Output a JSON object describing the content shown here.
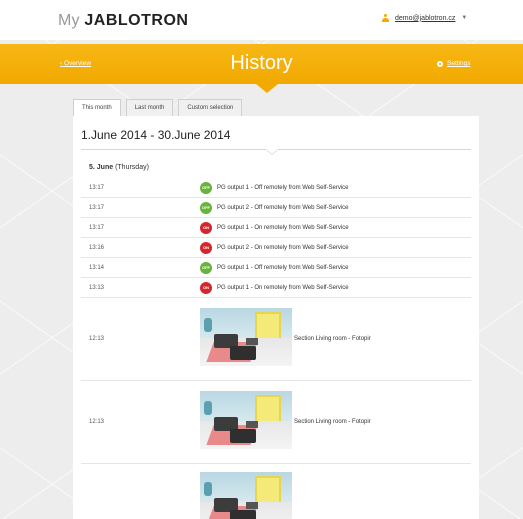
{
  "header": {
    "logo_my": "My",
    "logo_brand": "JABLOTRON",
    "user_email": "demo@jablotron.cz",
    "user_caret": "▼"
  },
  "nav": {
    "title": "History",
    "overview": "‹ Overview",
    "settings": "Settings"
  },
  "tabs": [
    {
      "label": "This month",
      "active": true
    },
    {
      "label": "Last month",
      "active": false
    },
    {
      "label": "Custom selection",
      "active": false
    }
  ],
  "range": "1.June 2014 - 30.June 2014",
  "day": {
    "date": "5. June",
    "weekday": "(Thursday)"
  },
  "events": [
    {
      "time": "13:17",
      "state": "OFF",
      "message": "PG output 1 - Off remotely from Web Self-Service"
    },
    {
      "time": "13:17",
      "state": "OFF",
      "message": "PG output 2 - Off remotely from Web Self-Service"
    },
    {
      "time": "13:17",
      "state": "ON",
      "message": "PG output 1 - On remotely from Web Self-Service"
    },
    {
      "time": "13:16",
      "state": "ON",
      "message": "PG output 2 - On remotely from Web Self-Service"
    },
    {
      "time": "13:14",
      "state": "OFF",
      "message": "PG output 1 - Off remotely from Web Self-Service"
    },
    {
      "time": "13:13",
      "state": "ON",
      "message": "PG output 1 - On remotely from Web Self-Service"
    }
  ],
  "photos": [
    {
      "time": "12:13",
      "message": "Section Living room - Fotopir"
    },
    {
      "time": "12:13",
      "message": "Section Living room - Fotopir"
    }
  ],
  "colors": {
    "accent": "#f2a900",
    "off_badge": "#68b33c",
    "on_badge": "#d7262b"
  },
  "icons": {
    "user": "user-icon",
    "settings": "gear-icon",
    "photo": "camera-photo"
  }
}
